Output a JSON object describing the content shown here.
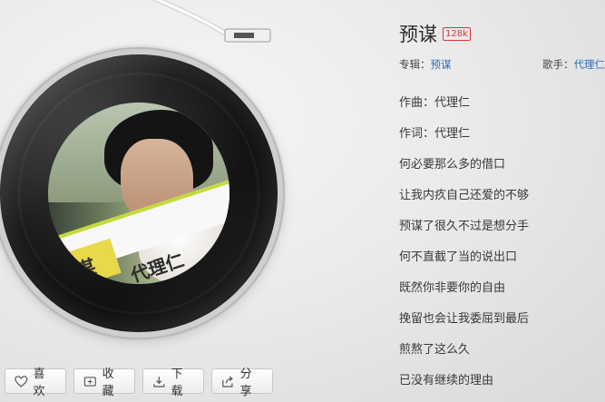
{
  "song": {
    "title": "预谋",
    "quality": "128k",
    "album_label": "专辑：",
    "album": "预谋",
    "artist_label": "歌手：",
    "artist": "代理仁"
  },
  "cover": {
    "text_left": "谋",
    "text_right": "代理仁"
  },
  "lyrics": [
    "作曲：代理仁",
    "作词：代理仁",
    "何必要那么多的借口",
    "让我内疚自己还爱的不够",
    "预谋了很久不过是想分手",
    "何不直截了当的说出口",
    "既然你非要你的自由",
    "挽留也会让我委屈到最后",
    "煎熬了这么久",
    "已没有继续的理由"
  ],
  "actions": {
    "like": "喜欢",
    "favorite": "收藏",
    "download": "下载",
    "share": "分享"
  },
  "icons": {
    "like": "heart-icon",
    "favorite": "add-folder-icon",
    "download": "download-icon",
    "share": "share-icon"
  }
}
